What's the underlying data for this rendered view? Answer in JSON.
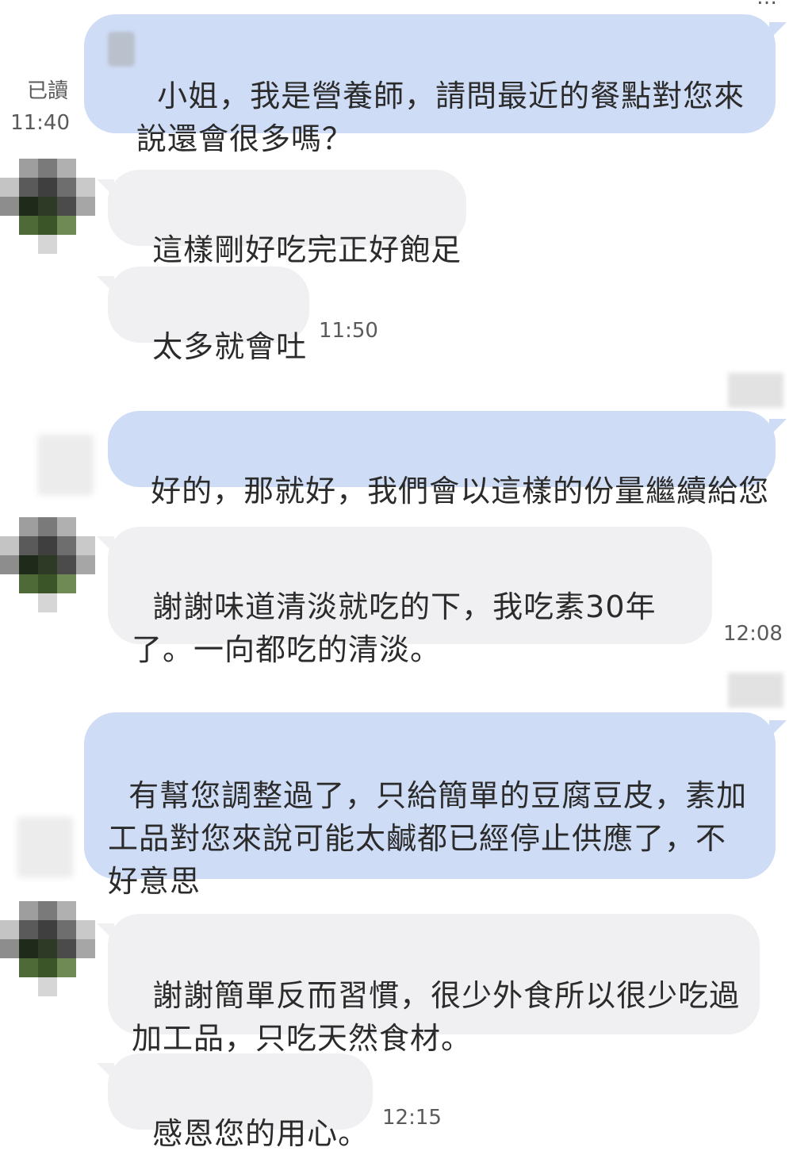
{
  "status": {
    "read_label": "已讀",
    "time_1": "11:40",
    "time_2": "11:50",
    "time_3": "12:08",
    "time_4": "12:15",
    "top_cut_text": "…"
  },
  "messages": [
    {
      "id": 1,
      "side": "out",
      "text": "小姐，我是營養師，請問最近的餐點對您來\n說還會很多嗎？"
    },
    {
      "id": 2,
      "side": "in",
      "text": "這樣剛好吃完正好飽足"
    },
    {
      "id": 3,
      "side": "in",
      "text": "太多就會吐"
    },
    {
      "id": 4,
      "side": "out",
      "text": "好的，那就好，我們會以這樣的份量繼續給您"
    },
    {
      "id": 5,
      "side": "in",
      "text": "謝謝味道清淡就吃的下，我吃素30年\n了。一向都吃的清淡。"
    },
    {
      "id": 6,
      "side": "out",
      "text": "有幫您調整過了，只給簡單的豆腐豆皮，素加\n工品對您來說可能太鹹都已經停止供應了，不\n好意思"
    },
    {
      "id": 7,
      "side": "in",
      "text": "謝謝簡單反而習慣，很少外食所以很少吃過\n加工品，只吃天然食材。"
    },
    {
      "id": 8,
      "side": "in",
      "text": "感恩您的用心。"
    }
  ],
  "colors": {
    "outgoing_bubble": "#cfdcf6",
    "incoming_bubble": "#f0f0f2"
  }
}
